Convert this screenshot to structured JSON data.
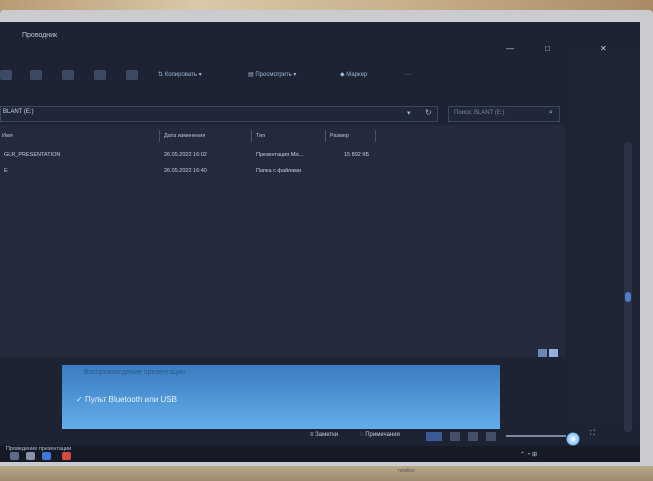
{
  "window": {
    "app_title": "Проводник",
    "minimize_label": "—",
    "maximize_label": "□",
    "close_label": "✕"
  },
  "toolbar": {
    "copy_label": "Копировать",
    "view_label": "Просмотреть",
    "more_label": "Маркер",
    "overflow_label": "···"
  },
  "address": {
    "path": "BLANT (E:)",
    "dropdown_icon": "chevron-down-icon"
  },
  "search": {
    "placeholder": "Поиск: BLANT (E:)"
  },
  "columns": [
    "Имя",
    "Дата изменения",
    "Тип",
    "Размер"
  ],
  "files": [
    {
      "name": "GLR_PRESENTATION",
      "date": "26.05.2022 16:02",
      "type": "Презентация Mic...",
      "size": "15 892 КБ"
    },
    {
      "name": "Е",
      "date": "26.05.2022 16:40",
      "type": "Папка с файлами",
      "size": ""
    }
  ],
  "overlay": {
    "line1": "Воспроизведение презентации",
    "line2": "Пульт Bluetooth или USB"
  },
  "bottombar": {
    "item1": "Заметки",
    "item2": "Примечания"
  },
  "taskbar": {
    "label": "Проведение презентации"
  },
  "bezel": {
    "brand": "newline"
  },
  "colors": {
    "screen_bg": "#1d2332",
    "accent": "#4a7fd0",
    "overlay": "#4f98d8"
  }
}
